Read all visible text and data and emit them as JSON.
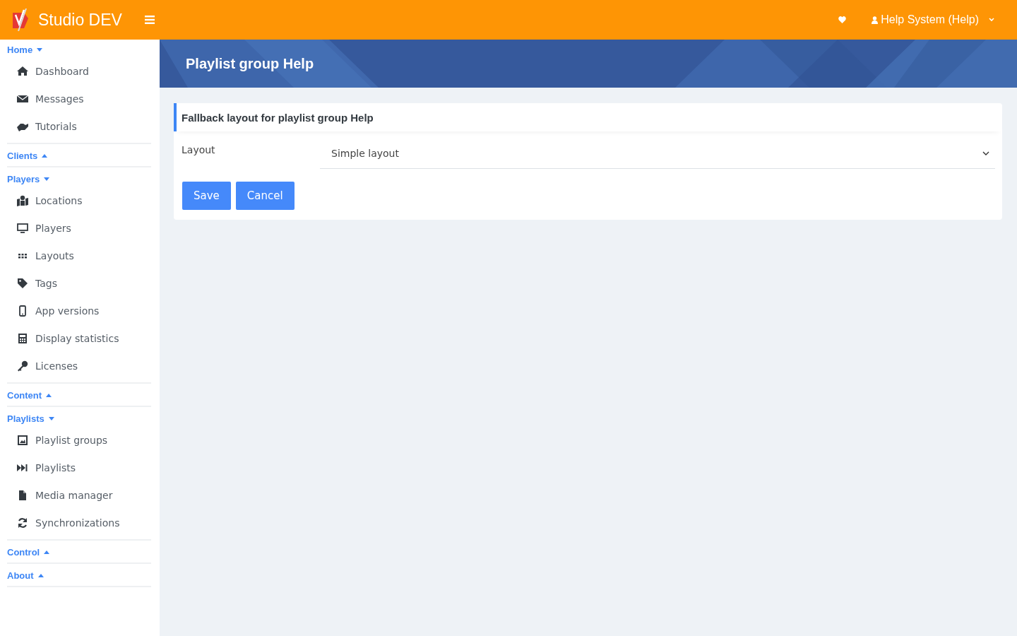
{
  "topbar": {
    "brand": "Studio DEV",
    "user": "Help System (Help)"
  },
  "sidebar": {
    "sections": [
      {
        "label": "Home",
        "expanded": true,
        "items": [
          {
            "label": "Dashboard"
          },
          {
            "label": "Messages"
          },
          {
            "label": "Tutorials"
          }
        ]
      },
      {
        "label": "Clients",
        "expanded": false
      },
      {
        "label": "Players",
        "expanded": true,
        "items": [
          {
            "label": "Locations"
          },
          {
            "label": "Players"
          },
          {
            "label": "Layouts"
          },
          {
            "label": "Tags"
          },
          {
            "label": "App versions"
          },
          {
            "label": "Display statistics"
          },
          {
            "label": "Licenses"
          }
        ]
      },
      {
        "label": "Content",
        "expanded": false
      },
      {
        "label": "Playlists",
        "expanded": true,
        "items": [
          {
            "label": "Playlist groups"
          },
          {
            "label": "Playlists"
          },
          {
            "label": "Media manager"
          },
          {
            "label": "Synchronizations"
          }
        ]
      },
      {
        "label": "Control",
        "expanded": false
      },
      {
        "label": "About",
        "expanded": false
      }
    ]
  },
  "page_title": "Playlist group Help",
  "card": {
    "title": "Fallback layout for playlist group Help",
    "field_label": "Layout",
    "field_value": "Simple layout",
    "buttons": [
      "Save",
      "Cancel"
    ]
  }
}
